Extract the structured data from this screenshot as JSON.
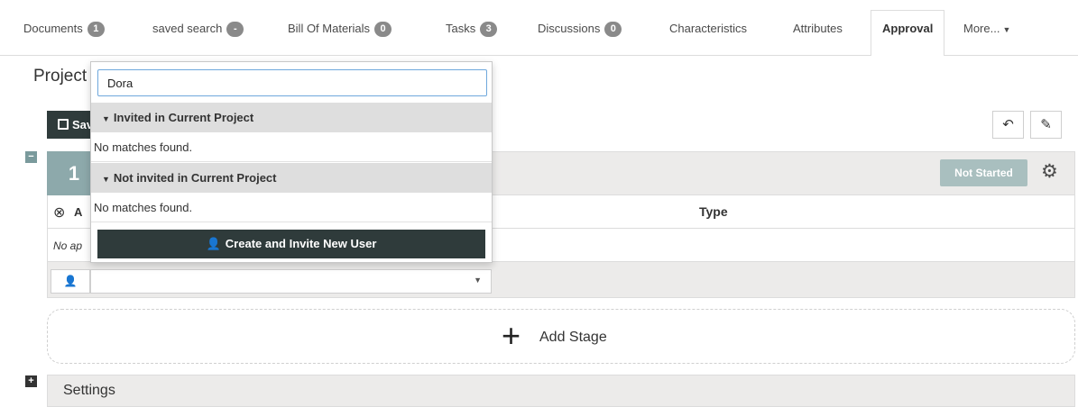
{
  "tabs": [
    {
      "label": "Documents",
      "count": "1"
    },
    {
      "label": "saved search",
      "count": "-"
    },
    {
      "label": "Bill Of Materials",
      "count": "0"
    },
    {
      "label": "Tasks",
      "count": "3"
    },
    {
      "label": "Discussions",
      "count": "0"
    },
    {
      "label": "Characteristics",
      "count": null
    },
    {
      "label": "Attributes",
      "count": null
    },
    {
      "label": "Approval",
      "count": null,
      "active": true
    },
    {
      "label": "More...",
      "count": null
    }
  ],
  "page": {
    "title": "Project"
  },
  "toolbar": {
    "save_label": "Save",
    "undo_icon": "undo-icon",
    "eraser_icon": "eraser-icon"
  },
  "stage": {
    "number": "1",
    "status": "Not Started",
    "columns": {
      "approver": "A",
      "type": "Type"
    },
    "empty_text": "No ap",
    "user_select_value": ""
  },
  "dropdown": {
    "search_value": "Dora",
    "groups": [
      {
        "label": "Invited in Current Project",
        "empty": "No matches found."
      },
      {
        "label": "Not invited in Current Project",
        "empty": "No matches found."
      }
    ],
    "create_label": "Create and Invite New User"
  },
  "add_stage": {
    "label": "Add Stage"
  },
  "settings": {
    "label": "Settings"
  },
  "colors": {
    "accent": "#8da9ab",
    "dark_button": "#2f3b3b",
    "badge": "#8a8a8a"
  }
}
